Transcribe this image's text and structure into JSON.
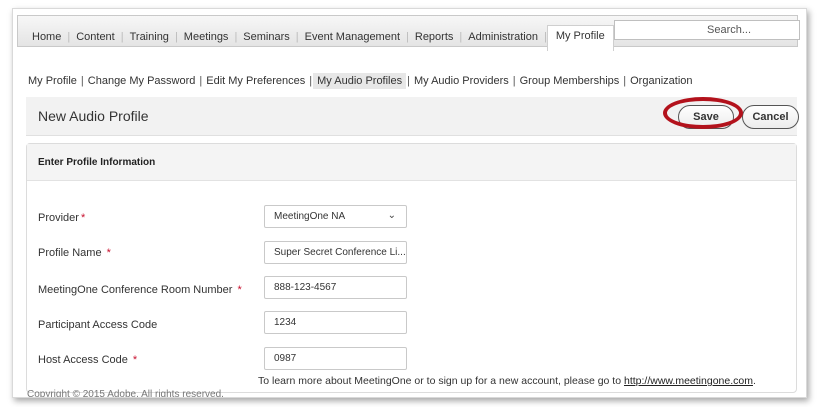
{
  "topnav": {
    "items": [
      "Home",
      "Content",
      "Training",
      "Meetings",
      "Seminars",
      "Event Management",
      "Reports",
      "Administration",
      "My Profile"
    ],
    "active": "My Profile",
    "search_placeholder": "Search..."
  },
  "subnav": {
    "items": [
      "My Profile",
      "Change My Password",
      "Edit My Preferences",
      "My Audio Profiles",
      "My Audio Providers",
      "Group Memberships",
      "Organization"
    ],
    "active": "My Audio Profiles"
  },
  "page": {
    "title": "New Audio Profile",
    "save_label": "Save",
    "cancel_label": "Cancel",
    "highlight_color": "#b3121c"
  },
  "form": {
    "section_title": "Enter Profile Information",
    "fields": [
      {
        "label": "Provider",
        "value": "MeetingOne NA",
        "required": true,
        "type": "select"
      },
      {
        "label": "Profile Name",
        "value": "Super Secret Conference Li...",
        "required": true,
        "type": "text"
      },
      {
        "label": "MeetingOne Conference Room Number",
        "value": "888-123-4567",
        "required": true,
        "type": "text"
      },
      {
        "label": "Participant Access Code",
        "value": "1234",
        "required": false,
        "type": "text"
      },
      {
        "label": "Host Access Code",
        "value": "0987",
        "required": true,
        "type": "text"
      }
    ],
    "footnote_text": "To learn more about MeetingOne or to sign up for a new account, please go to",
    "footnote_link": "http://www.meetingone.com",
    "footnote_end": "."
  },
  "footer": {
    "copyright": "Copyright © 2015 Adobe. All rights reserved."
  }
}
